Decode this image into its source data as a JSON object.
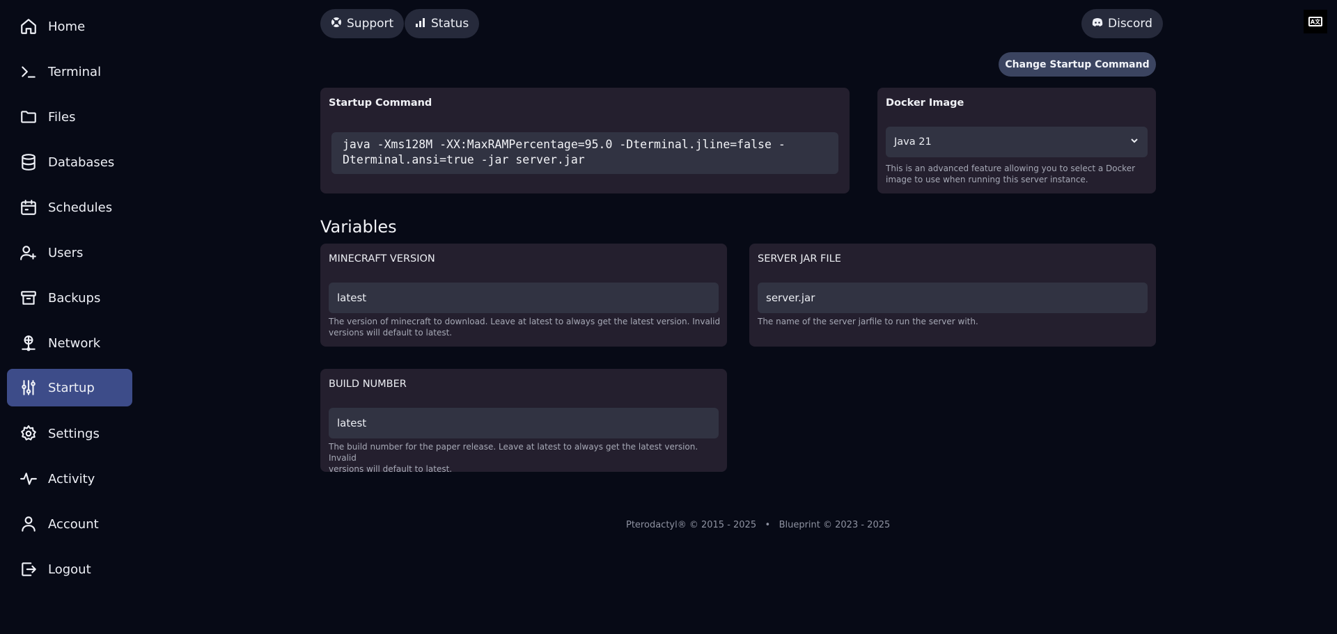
{
  "sidebar": {
    "items": [
      {
        "label": "Home",
        "icon": "home-icon"
      },
      {
        "label": "Terminal",
        "icon": "terminal-icon"
      },
      {
        "label": "Files",
        "icon": "folder-icon"
      },
      {
        "label": "Databases",
        "icon": "database-icon"
      },
      {
        "label": "Schedules",
        "icon": "calendar-icon"
      },
      {
        "label": "Users",
        "icon": "user-plus-icon"
      },
      {
        "label": "Backups",
        "icon": "archive-icon"
      },
      {
        "label": "Network",
        "icon": "network-icon"
      },
      {
        "label": "Startup",
        "icon": "sliders-icon",
        "active": true
      },
      {
        "label": "Settings",
        "icon": "gear-icon"
      },
      {
        "label": "Activity",
        "icon": "activity-icon"
      },
      {
        "label": "Account",
        "icon": "user-icon"
      },
      {
        "label": "Logout",
        "icon": "logout-icon"
      }
    ]
  },
  "header": {
    "support_label": "Support",
    "status_label": "Status",
    "discord_label": "Discord",
    "language_icon": "language-icon"
  },
  "toolbar": {
    "change_startup_label": "Change Startup Command"
  },
  "startup": {
    "title": "Startup Command",
    "command_line1": "java -Xms128M -XX:MaxRAMPercentage=95.0 -Dterminal.jline=false -",
    "command_line2": "Dterminal.ansi=true -jar server.jar"
  },
  "docker": {
    "title": "Docker Image",
    "selected": "Java 21",
    "help_line1": "This is an advanced feature allowing you to select a Docker",
    "help_line2": "image to use when running this server instance."
  },
  "variables": {
    "title": "Variables",
    "items": [
      {
        "name": "MINECRAFT VERSION",
        "value": "latest",
        "help_line1": "The version of minecraft to download. Leave at latest to always get the latest version. Invalid",
        "help_line2": "versions will default to latest."
      },
      {
        "name": "SERVER JAR FILE",
        "value": "server.jar",
        "help_line1": "The name of the server jarfile to run the server with.",
        "help_line2": ""
      },
      {
        "name": "BUILD NUMBER",
        "value": "latest",
        "help_line1": "The build number for the paper release. Leave at latest to always get the latest version. Invalid",
        "help_line2": "versions will default to latest."
      }
    ]
  },
  "footer": {
    "text": "Pterodactyl® © 2015 - 2025   •   Blueprint © 2023 - 2025"
  },
  "colors": {
    "background": "#070a16",
    "card": "#241f2e",
    "input": "#313342",
    "active_nav": "#3d4c89"
  }
}
